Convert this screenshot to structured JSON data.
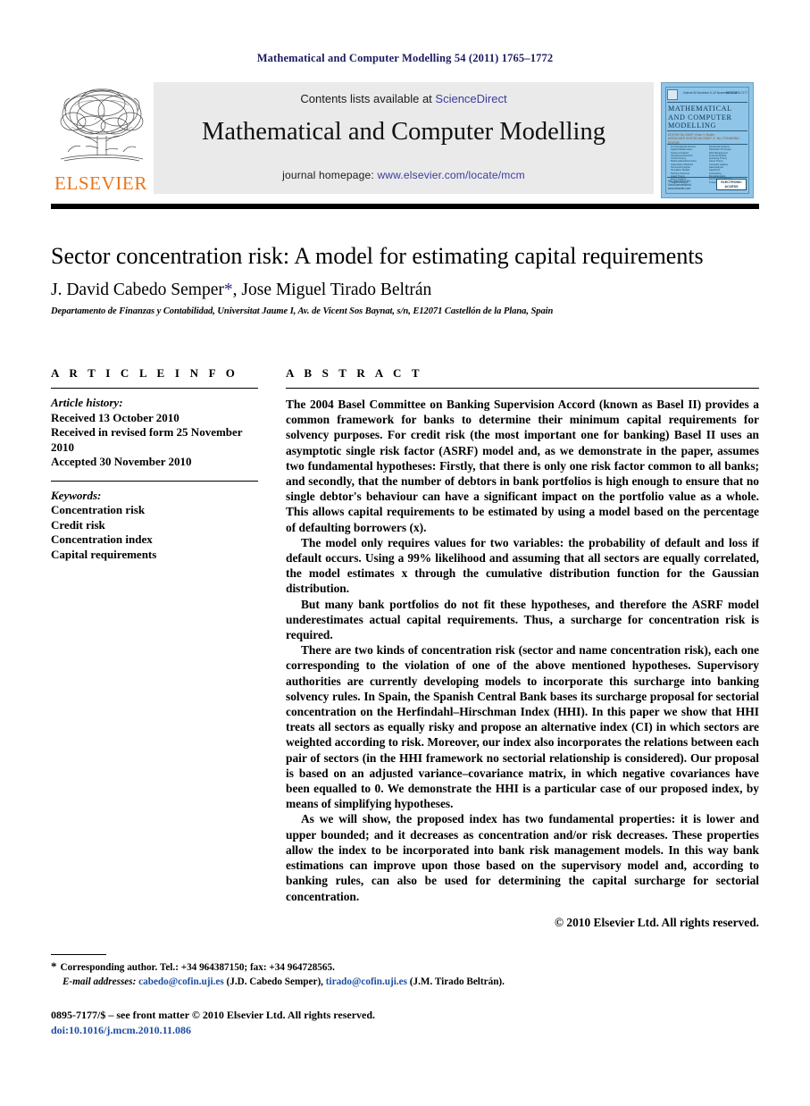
{
  "running_head": "Mathematical and Computer Modelling 54 (2011) 1765–1772",
  "masthead": {
    "publisher_name": "ELSEVIER",
    "publisher_logo_alt": "elsevier-tree-logo",
    "contents_prefix": "Contents lists available at ",
    "contents_link": "ScienceDirect",
    "journal_title": "Mathematical and Computer Modelling",
    "homepage_prefix": "journal homepage: ",
    "homepage_link": "www.elsevier.com/locate/mcm"
  },
  "cover": {
    "volume_line": "Volume 54 Numbers 9–10  November 2011",
    "issn_line": "ISSN 0895-7177",
    "title": "MATHEMATICAL AND COMPUTER MODELLING",
    "editors_line": "EDITOR-IN-CHIEF: Ervin Y. Rodin",
    "editors_line2": "ASSOCIATE EDITOR-IN-CHIEF: X. Hu  |  FOUNDING EDITOR",
    "toc_col1": "An International Journal\nApplied Mathematics\nSystems Analysis\nOperations Research\nControl Theory\nMathematical Economics\nOptimization Methods\nNumerical Analysis\nSimulation Models\nDecision Sciences\nGraph Theory\nFuzzy Systems\nNeural Networks\nStatistical Models",
    "toc_col2": "Dynamical Systems\nStochastic Processes\nRisk Management\nFinancial Models\nQueueing Theory\nGame Theory\nComputer Algebra\nData Analysis\nAlgorithms\nForecasting\nBiomathematics\nEnvironmental Models\nTransport Models\nEngineering Models",
    "sponsor": "SPONSORED BY\nGeoScienceWorld\nwww.elsevier.com",
    "electronic_access": "ELECTRONIC ACCESS"
  },
  "article": {
    "title": "Sector concentration risk: A model for estimating capital requirements",
    "authors_before_star": "J. David Cabedo Semper",
    "corresponding_star": "*",
    "authors_after_star": ", Jose Miguel Tirado Beltrán",
    "affiliation": "Departamento de Finanzas y Contabilidad, Universitat Jaume I, Av. de Vicent Sos Baynat, s/n, E12071 Castellón de la Plana, Spain"
  },
  "article_info": {
    "heading": "A R T I C L E   I N F O",
    "history_label": "Article history:",
    "history": [
      "Received 13 October 2010",
      "Received in revised form 25 November 2010",
      "Accepted 30 November 2010"
    ],
    "keywords_label": "Keywords:",
    "keywords": [
      "Concentration risk",
      "Credit risk",
      "Concentration index",
      "Capital requirements"
    ]
  },
  "abstract": {
    "heading": "A B S T R A C T",
    "paragraphs": [
      "The 2004 Basel Committee on Banking Supervision Accord (known as Basel II) provides a common framework for banks to determine their minimum capital requirements for solvency purposes. For credit risk (the most important one for banking) Basel II uses an asymptotic single risk factor (ASRF) model and, as we demonstrate in the paper, assumes two fundamental hypotheses: Firstly, that there is only one risk factor common to all banks; and secondly, that the number of debtors in bank portfolios is high enough to ensure that no single debtor's behaviour can have a significant impact on the portfolio value as a whole. This allows capital requirements to be estimated by using a model based on the percentage of defaulting borrowers (x).",
      "The model only requires values for two variables: the probability of default and loss if default occurs. Using a 99% likelihood and assuming that all sectors are equally correlated, the model estimates x through the cumulative distribution function for the Gaussian distribution.",
      "But many bank portfolios do not fit these hypotheses, and therefore the ASRF model underestimates actual capital requirements. Thus, a surcharge for concentration risk is required.",
      "There are two kinds of concentration risk (sector and name concentration risk), each one corresponding to the violation of one of the above mentioned hypotheses. Supervisory authorities are currently developing models to incorporate this surcharge into banking solvency rules. In Spain, the Spanish Central Bank bases its surcharge proposal for sectorial concentration on the Herfindahl–Hirschman Index (HHI). In this paper we show that HHI treats all sectors as equally risky and propose an alternative index (CI) in which sectors are weighted according to risk. Moreover, our index also incorporates the relations between each pair of sectors (in the HHI framework no sectorial relationship is considered). Our proposal is based on an adjusted variance–covariance matrix, in which negative covariances have been equalled to 0. We demonstrate the HHI is a particular case of our proposed index, by means of simplifying hypotheses.",
      "As we will show, the proposed index has two fundamental properties: it is lower and upper bounded; and it decreases as concentration and/or risk decreases. These properties allow the index to be incorporated into bank risk management models. In this way bank estimations can improve upon those based on the supervisory model and, according to banking rules, can also be used for determining the capital surcharge for sectorial concentration."
    ],
    "copyright": "© 2010 Elsevier Ltd. All rights reserved."
  },
  "footnotes": {
    "star": "*",
    "corresponding": "Corresponding author. Tel.: +34 964387150; fax: +34 964728565.",
    "email_label": "E-mail addresses:",
    "email1": "cabedo@cofin.uji.es",
    "email1_owner": "(J.D. Cabedo Semper),",
    "email2": "tirado@cofin.uji.es",
    "email2_owner": "(J.M. Tirado Beltrán)."
  },
  "imprint": {
    "front_matter": "0895-7177/$ – see front matter © 2010 Elsevier Ltd. All rights reserved.",
    "doi": "doi:10.1016/j.mcm.2010.11.086"
  }
}
